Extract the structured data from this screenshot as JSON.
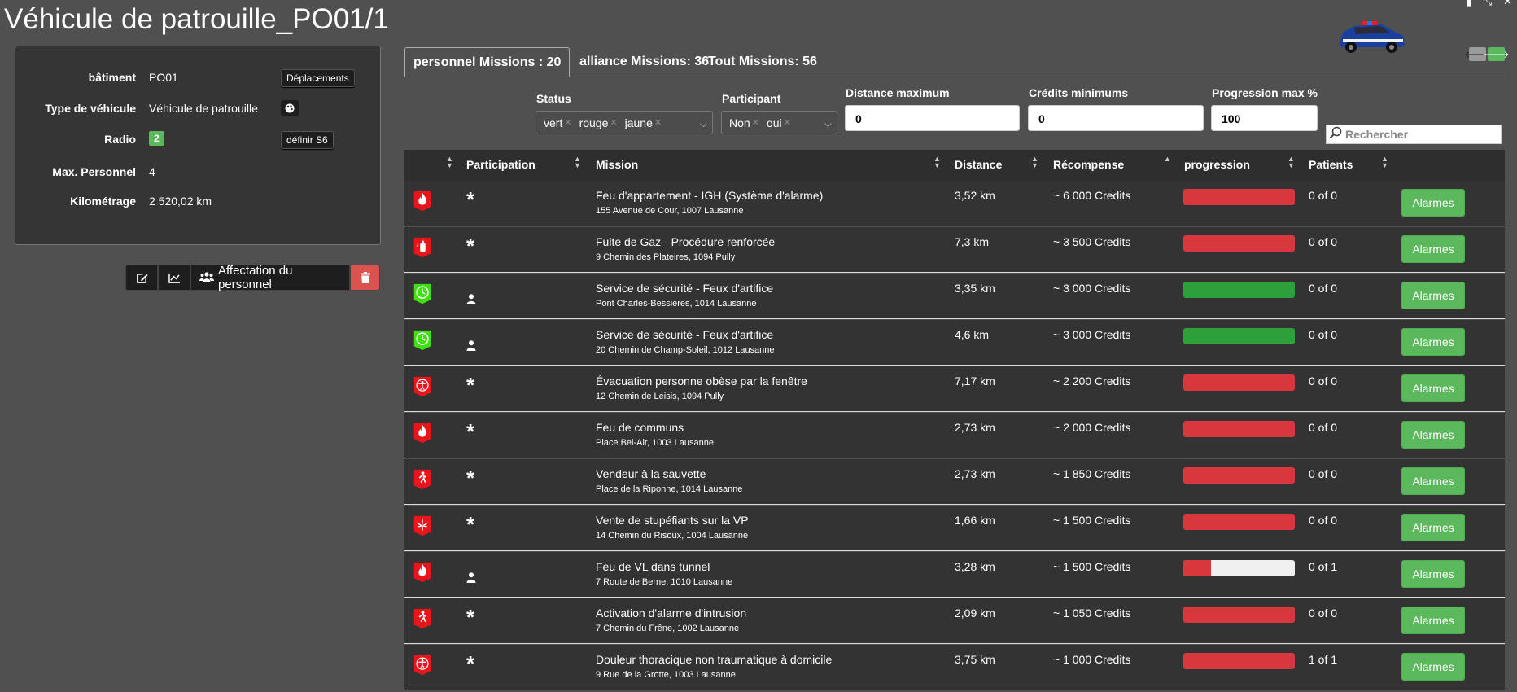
{
  "page": {
    "title": "Véhicule de patrouille_PO01/1"
  },
  "top_icons": [
    "clipboard-icon",
    "compress-icon",
    "close-icon"
  ],
  "info": {
    "batiment_label": "bâtiment",
    "batiment_value": "PO01",
    "deplacements_label": "Déplacements",
    "type_label": "Type de véhicule",
    "type_value": "Véhicule de patrouille",
    "radio_label": "Radio",
    "radio_value": "2",
    "definir_label": "définir S6",
    "max_personnel_label": "Max. Personnel",
    "max_personnel_value": "4",
    "kilometrage_label": "Kilométrage",
    "kilometrage_value": "2 520,02 km"
  },
  "actions": {
    "affectation_label": "Affectation du personnel"
  },
  "tabs": [
    {
      "label": "personnel Missions : 20",
      "active": true
    },
    {
      "label": "alliance Missions: 36",
      "active": false
    },
    {
      "label": "Tout Missions: 56",
      "active": false
    }
  ],
  "filters": {
    "status_label": "Status",
    "status_options": [
      "vert",
      "rouge",
      "jaune"
    ],
    "participant_label": "Participant",
    "participant_options": [
      "Non",
      "oui"
    ],
    "distance_label": "Distance maximum",
    "distance_value": "0",
    "credits_label": "Crédits minimums",
    "credits_value": "0",
    "progression_label": "Progression max %",
    "progression_value": "100",
    "search_placeholder": "Rechercher"
  },
  "columns": [
    "Participation",
    "Mission",
    "Distance",
    "Récompense",
    "progression",
    "Patients"
  ],
  "colors": {
    "red_icon": "#e8161b",
    "green_icon": "#3ee011",
    "progress_red": "#d9373e",
    "progress_green": "#2ea03a",
    "button_green": "#5cb85c"
  },
  "missions": [
    {
      "icon": "fire-icon",
      "icon_color": "#e8161b",
      "participation": "*",
      "participation_icon": "asterisk-icon",
      "name": "Feu d'appartement - IGH (Système d'alarme)",
      "address": "155 Avenue de Cour, 1007 Lausanne",
      "distance": "3,52 km",
      "reward": "~ 6 000 Credits",
      "progress": 1.0,
      "progress_color": "#d9373e",
      "patients": "0 of 0",
      "button": "Alarmes"
    },
    {
      "icon": "gas-leak-icon",
      "icon_color": "#e8161b",
      "participation": "*",
      "participation_icon": "asterisk-icon",
      "name": "Fuite de Gaz - Procédure renforcée",
      "address": "9 Chemin des Plateires, 1094 Pully",
      "distance": "7,3 km",
      "reward": "~ 3 500 Credits",
      "progress": 1.0,
      "progress_color": "#d9373e",
      "patients": "0 of 0",
      "button": "Alarmes"
    },
    {
      "icon": "clock-icon",
      "icon_color": "#3ee011",
      "participation": "",
      "participation_icon": "user-icon",
      "name": "Service de sécurité - Feux d'artifice",
      "address": "Pont Charles-Bessières, 1014 Lausanne",
      "distance": "3,35 km",
      "reward": "~ 3 000 Credits",
      "progress": 1.0,
      "progress_color": "#2ea03a",
      "patients": "0 of 0",
      "button": "Alarmes"
    },
    {
      "icon": "clock-icon",
      "icon_color": "#3ee011",
      "participation": "",
      "participation_icon": "user-icon",
      "name": "Service de sécurité - Feux d'artifice",
      "address": "20 Chemin de Champ-Soleil, 1012 Lausanne",
      "distance": "4,6 km",
      "reward": "~ 3 000 Credits",
      "progress": 1.0,
      "progress_color": "#2ea03a",
      "patients": "0 of 0",
      "button": "Alarmes"
    },
    {
      "icon": "person-circle-icon",
      "icon_color": "#e8161b",
      "participation": "*",
      "participation_icon": "asterisk-icon",
      "name": "Évacuation personne obèse par la fenêtre",
      "address": "12 Chemin de Leisis, 1094 Pully",
      "distance": "7,17 km",
      "reward": "~ 2 200 Credits",
      "progress": 1.0,
      "progress_color": "#d9373e",
      "patients": "0 of 0",
      "button": "Alarmes"
    },
    {
      "icon": "fire-icon",
      "icon_color": "#e8161b",
      "participation": "*",
      "participation_icon": "asterisk-icon",
      "name": "Feu de communs",
      "address": "Place Bel-Air, 1003 Lausanne",
      "distance": "2,73 km",
      "reward": "~ 2 000 Credits",
      "progress": 1.0,
      "progress_color": "#d9373e",
      "patients": "0 of 0",
      "button": "Alarmes"
    },
    {
      "icon": "running-person-icon",
      "icon_color": "#e8161b",
      "participation": "*",
      "participation_icon": "asterisk-icon",
      "name": "Vendeur à la sauvette",
      "address": "Place de la Riponne, 1014 Lausanne",
      "distance": "2,73 km",
      "reward": "~ 1 850 Credits",
      "progress": 1.0,
      "progress_color": "#d9373e",
      "patients": "0 of 0",
      "button": "Alarmes"
    },
    {
      "icon": "cannabis-leaf-icon",
      "icon_color": "#e8161b",
      "participation": "*",
      "participation_icon": "asterisk-icon",
      "name": "Vente de stupéfiants sur la VP",
      "address": "14 Chemin du Risoux, 1004 Lausanne",
      "distance": "1,66 km",
      "reward": "~ 1 500 Credits",
      "progress": 1.0,
      "progress_color": "#d9373e",
      "patients": "0 of 0",
      "button": "Alarmes"
    },
    {
      "icon": "fire-icon",
      "icon_color": "#e8161b",
      "participation": "",
      "participation_icon": "user-icon",
      "name": "Feu de VL dans tunnel",
      "address": "7 Route de Berne, 1010 Lausanne",
      "distance": "3,28 km",
      "reward": "~ 1 500 Credits",
      "progress": 0.25,
      "progress_color": "#d9373e",
      "patients": "0 of 1",
      "button": "Alarmes"
    },
    {
      "icon": "running-person-icon",
      "icon_color": "#e8161b",
      "participation": "*",
      "participation_icon": "asterisk-icon",
      "name": "Activation d'alarme d'intrusion",
      "address": "7 Chemin du Frêne, 1002 Lausanne",
      "distance": "2,09 km",
      "reward": "~ 1 050 Credits",
      "progress": 1.0,
      "progress_color": "#d9373e",
      "patients": "0 of 0",
      "button": "Alarmes"
    },
    {
      "icon": "person-circle-icon",
      "icon_color": "#e8161b",
      "participation": "*",
      "participation_icon": "asterisk-icon",
      "name": "Douleur thoracique non traumatique à domicile",
      "address": "9 Rue de la Grotte, 1003 Lausanne",
      "distance": "3,75 km",
      "reward": "~ 1 000 Credits",
      "progress": 1.0,
      "progress_color": "#d9373e",
      "patients": "1 of 1",
      "button": "Alarmes"
    }
  ]
}
